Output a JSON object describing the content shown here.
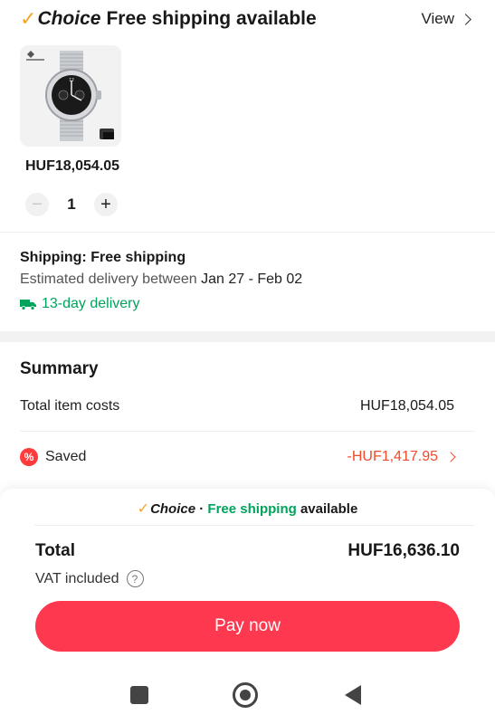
{
  "header": {
    "choice_label": "Choice",
    "title": "Free shipping available",
    "view_label": "View"
  },
  "product": {
    "image_icon": "watch-image",
    "price": "HUF18,054.05",
    "quantity": "1",
    "minus_symbol": "−",
    "plus_symbol": "+"
  },
  "shipping": {
    "title": "Shipping: Free shipping",
    "estimate_prefix": "Estimated delivery between",
    "estimate_dates": "Jan 27 - Feb 02",
    "delivery_label": "13-day delivery",
    "delivery_icon": "truck-icon"
  },
  "summary": {
    "title": "Summary",
    "item_costs_label": "Total item costs",
    "item_costs_value": "HUF18,054.05",
    "saved_label": "Saved",
    "saved_value": "-HUF1,417.95",
    "saved_icon_text": "%"
  },
  "banner": {
    "choice_label": "Choice",
    "separator": "·",
    "free_shipping": "Free shipping",
    "available": "available"
  },
  "total": {
    "label": "Total",
    "value": "HUF16,636.10",
    "vat_label": "VAT included",
    "help_symbol": "?"
  },
  "pay_button_label": "Pay now",
  "colors": {
    "accent": "#fd384f",
    "green": "#00a35c",
    "saved": "#f04b2c",
    "choice_check": "#f5a623"
  }
}
